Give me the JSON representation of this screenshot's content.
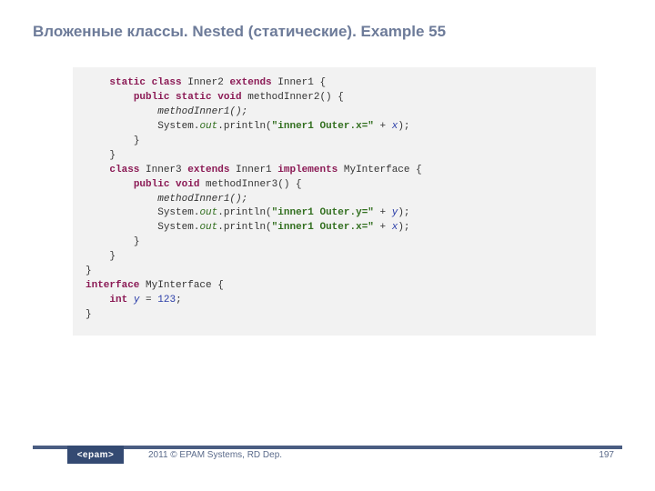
{
  "title": "Вложенные классы. Nested (статические). Example 55",
  "code": {
    "l1": {
      "indent": "    ",
      "kw1": "static class",
      "cls": " Inner2 ",
      "kw2": "extends",
      "base": " Inner1 {"
    },
    "l2": {
      "indent": "        ",
      "kw": "public static void",
      "sig": " methodInner2() {"
    },
    "l3": {
      "indent": "            ",
      "call": "methodInner1();"
    },
    "l4": {
      "indent": "            ",
      "pre": "System.",
      "out": "out",
      "mid": ".println(",
      "str": "\"inner1 Outer.x=\"",
      "plus": " + ",
      "fld": "x",
      "post": ");"
    },
    "l5": {
      "indent": "        ",
      "brace": "}"
    },
    "l6": {
      "indent": "    ",
      "brace": "}"
    },
    "l7": {
      "indent": "    ",
      "kw1": "class",
      "cls": " Inner3 ",
      "kw2": "extends",
      "base": " Inner1 ",
      "kw3": "implements",
      "iface": " MyInterface {"
    },
    "l8": {
      "indent": "        ",
      "kw": "public void",
      "sig": " methodInner3() {"
    },
    "l9": {
      "indent": "            ",
      "call": "methodInner1();"
    },
    "l10": {
      "indent": "            ",
      "pre": "System.",
      "out": "out",
      "mid": ".println(",
      "str": "\"inner1 Outer.y=\"",
      "plus": " + ",
      "fld": "y",
      "post": ");"
    },
    "l11": {
      "indent": "            ",
      "pre": "System.",
      "out": "out",
      "mid": ".println(",
      "str": "\"inner1 Outer.x=\"",
      "plus": " + ",
      "fld": "x",
      "post": ");"
    },
    "l12": {
      "indent": "        ",
      "brace": "}"
    },
    "l13": {
      "indent": "    ",
      "brace": "}"
    },
    "l14": {
      "indent": "",
      "brace": "}"
    },
    "l15": {
      "indent": "",
      "kw": "interface",
      "name": " MyInterface {"
    },
    "l16": {
      "indent": "    ",
      "kw": "int",
      "sp": " ",
      "fld": "y",
      "eq": " = ",
      "num": "123",
      "semi": ";"
    },
    "l17": {
      "indent": "",
      "brace": "}"
    }
  },
  "footer": {
    "logo_text": "<epam>",
    "copyright": "2011 © EPAM Systems, RD Dep.",
    "page_number": "197"
  }
}
